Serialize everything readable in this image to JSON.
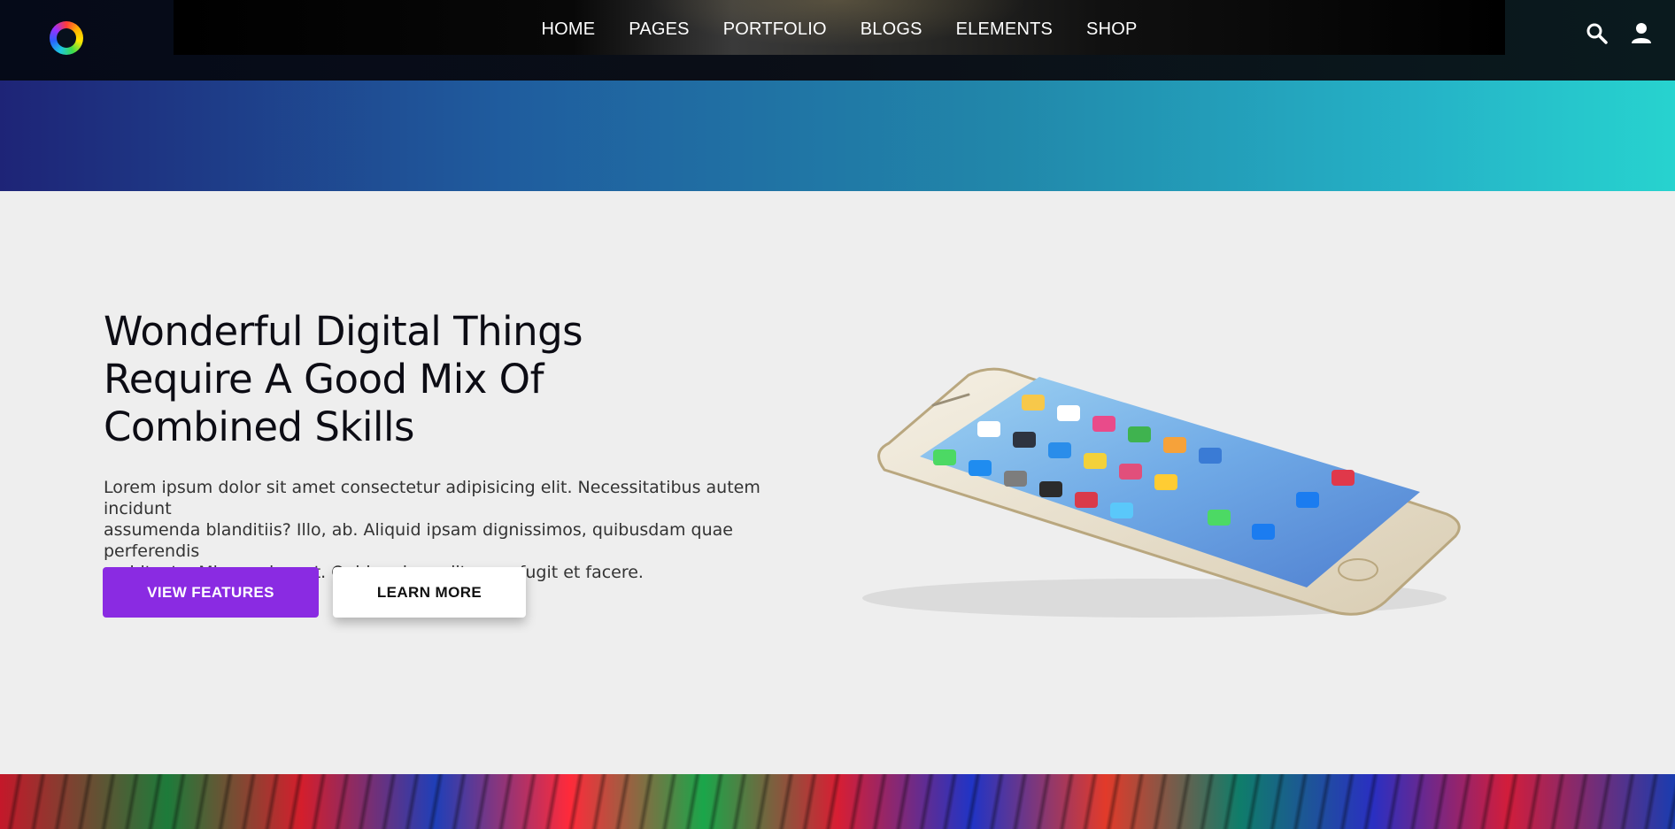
{
  "header": {
    "logo_icon": "ring-logo",
    "nav": [
      "HOME",
      "PAGES",
      "PORTFOLIO",
      "BLOGS",
      "ELEMENTS",
      "SHOP"
    ],
    "icons": [
      "search-icon",
      "user-icon"
    ]
  },
  "banner": {
    "gradient_colors": [
      "#1e2477",
      "#27d3cf"
    ]
  },
  "hero": {
    "title_line1": "Wonderful Digital Things",
    "title_line2": "Require A Good Mix Of",
    "title_line3": "Combined Skills",
    "text_line1": "Lorem ipsum dolor sit amet consectetur adipisicing elit. Necessitatibus autem incidunt",
    "text_line2": "assumenda blanditiis? Illo, ab. Aliquid ipsam dignissimos, quibusdam quae perferendis",
    "text_line3": "architecto. Minus, placeat. Quidem impedit quae fugit et facere.",
    "primary_button": "VIEW FEATURES",
    "secondary_button": "LEARN MORE",
    "image": "smartphone-image"
  },
  "colors": {
    "accent": "#8a2be2",
    "background": "#eeeeee",
    "header": "#07101c"
  }
}
